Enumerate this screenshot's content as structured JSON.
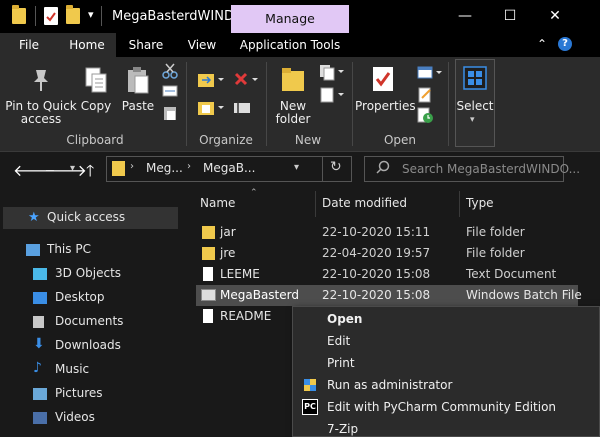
{
  "window": {
    "title": "MegaBasterdWINDO...",
    "manage_tab": "Manage",
    "minimize": "—",
    "maximize": "☐",
    "close": "✕"
  },
  "ribbon_tabs": {
    "file": "File",
    "home": "Home",
    "share": "Share",
    "view": "View",
    "app_tools": "Application Tools",
    "collapse": "⌃",
    "help": "?"
  },
  "ribbon": {
    "clipboard": {
      "pin_label_1": "Pin to Quick",
      "pin_label_2": "access",
      "copy": "Copy",
      "paste": "Paste",
      "group": "Clipboard"
    },
    "organize": {
      "group": "Organize"
    },
    "new": {
      "new_folder_1": "New",
      "new_folder_2": "folder",
      "group": "New"
    },
    "open": {
      "properties": "Properties",
      "group": "Open"
    },
    "select": {
      "label": "Select"
    }
  },
  "address": {
    "crumb1": "Meg...",
    "crumb2": "MegaB...",
    "search_placeholder": "Search MegaBasterdWINDO..."
  },
  "nav": {
    "items": [
      {
        "label": "Quick access",
        "icon": "star-icon"
      },
      {
        "label": "This PC",
        "icon": "computer-icon"
      },
      {
        "label": "3D Objects",
        "icon": "cube-icon"
      },
      {
        "label": "Desktop",
        "icon": "desktop-icon"
      },
      {
        "label": "Documents",
        "icon": "documents-icon"
      },
      {
        "label": "Downloads",
        "icon": "download-icon"
      },
      {
        "label": "Music",
        "icon": "music-icon"
      },
      {
        "label": "Pictures",
        "icon": "pictures-icon"
      },
      {
        "label": "Videos",
        "icon": "videos-icon"
      }
    ]
  },
  "columns": {
    "name": "Name",
    "date": "Date modified",
    "type": "Type"
  },
  "files": [
    {
      "name": "jar",
      "date": "22-10-2020 15:11",
      "type": "File folder"
    },
    {
      "name": "jre",
      "date": "22-04-2020 19:57",
      "type": "File folder"
    },
    {
      "name": "LEEME",
      "date": "22-10-2020 15:08",
      "type": "Text Document"
    },
    {
      "name": "MegaBasterd",
      "date": "22-10-2020 15:08",
      "type": "Windows Batch File"
    },
    {
      "name": "README",
      "date": "",
      "type": ""
    }
  ],
  "context_menu": {
    "open": "Open",
    "edit": "Edit",
    "print": "Print",
    "run_as_admin": "Run as administrator",
    "pycharm": "Edit with PyCharm Community Edition",
    "zip": "7-Zip",
    "pycharm_icon_text": "PC"
  },
  "colors": {
    "manage_tab": "#e1c8f5",
    "selected_row": "#4d4d4d",
    "folder": "#f0c94c",
    "accent_blue": "#2a78d4"
  }
}
